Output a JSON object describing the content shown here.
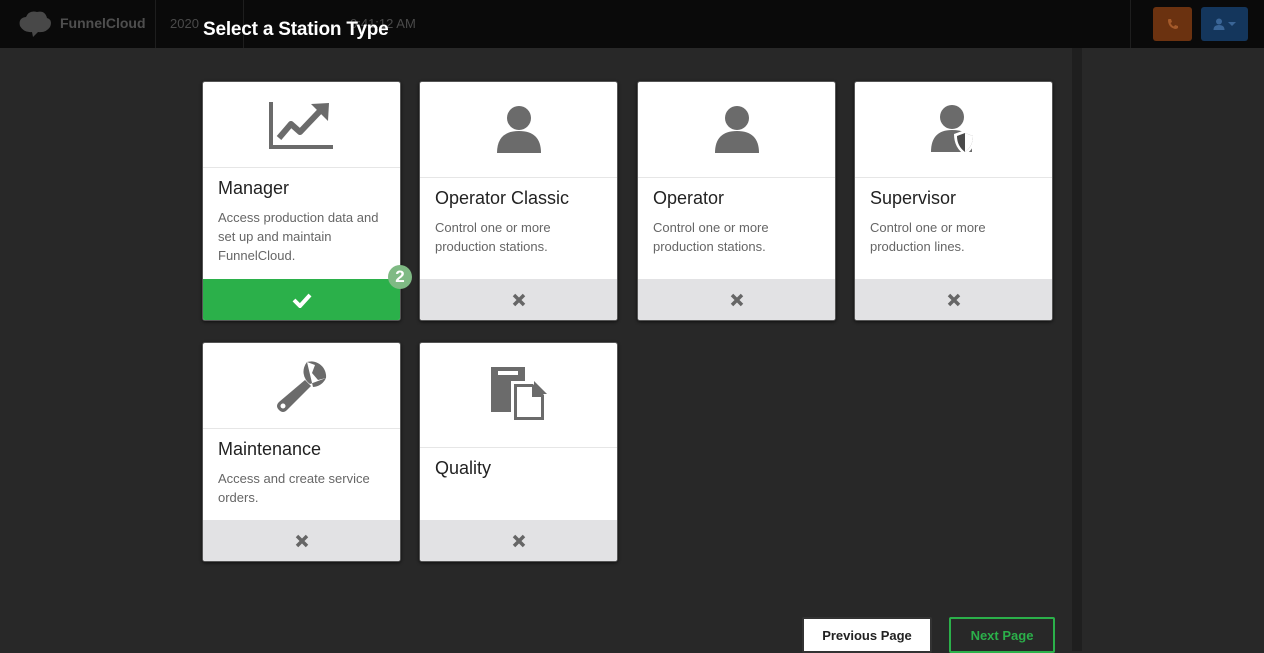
{
  "app": {
    "brand": "FunnelCloud",
    "date": "2020",
    "time": "0:41:12 AM"
  },
  "page": {
    "title": "Select a Station Type"
  },
  "stations": [
    {
      "title": "Manager",
      "description": "Access production data and set up and maintain FunnelCloud.",
      "icon": "chart-line-icon",
      "selected": true
    },
    {
      "title": "Operator Classic",
      "description": "Control one or more production stations.",
      "icon": "user-icon",
      "selected": false
    },
    {
      "title": "Operator",
      "description": "Control one or more production stations.",
      "icon": "user-icon",
      "selected": false
    },
    {
      "title": "Supervisor",
      "description": "Control one or more production lines.",
      "icon": "user-shield-icon",
      "selected": false
    },
    {
      "title": "Maintenance",
      "description": "Access and create service orders.",
      "icon": "wrench-icon",
      "selected": false
    },
    {
      "title": "Quality",
      "description": "",
      "icon": "documents-icon",
      "selected": false
    }
  ],
  "badge": {
    "count": "2"
  },
  "nav": {
    "previous_label": "Previous Page",
    "next_label": "Next Page"
  },
  "colors": {
    "selected": "#2bb04a",
    "background": "#282828"
  }
}
